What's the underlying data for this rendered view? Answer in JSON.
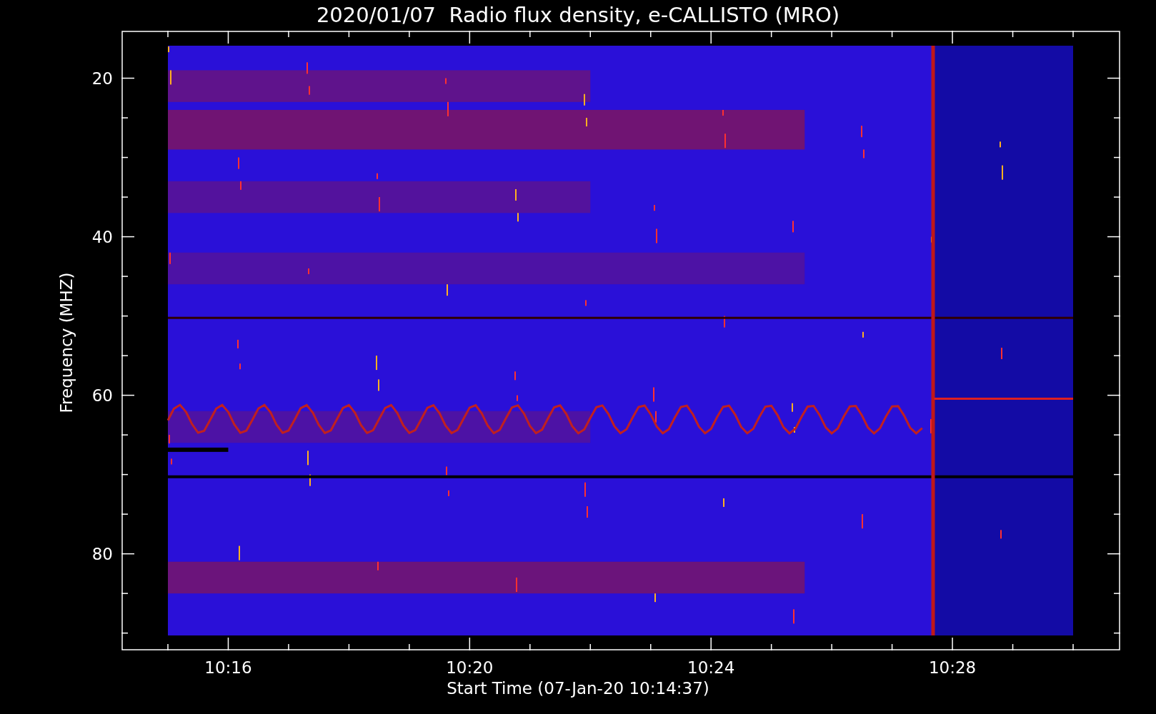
{
  "plot": {
    "title": "2020/01/07  Radio flux density, e-CALLISTO (MRO)",
    "ylabel": "Frequency (MHZ)",
    "xlabel": "Start Time (07-Jan-20 10:14:37)",
    "yticks": [
      "20",
      "40",
      "60",
      "80"
    ],
    "xticks": [
      "10:16",
      "10:20",
      "10:24",
      "10:28"
    ]
  }
}
